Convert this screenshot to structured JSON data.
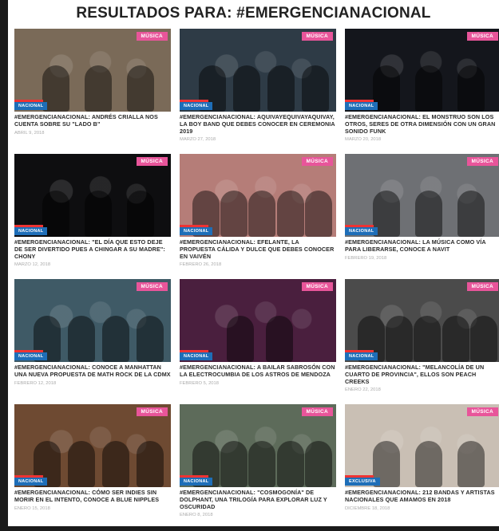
{
  "page": {
    "title": "RESULTADOS PARA: #EMERGENCIANACIONAL"
  },
  "colors": {
    "genre_badge": "#e8559a",
    "section_badge": "#1e6eb8",
    "rail": "#1a1a1a"
  },
  "cards": [
    {
      "genre": "MÚSICA",
      "section": "NACIONAL",
      "title": "#EMERGENCIANACIONAL: ANDRÉS CRIALLA NOS CUENTA SOBRE SU \"LADO B\"",
      "date": "ABRIL 9, 2018",
      "bg": "#7a6a58",
      "figures": 3
    },
    {
      "genre": "MÚSICA",
      "section": "NACIONAL",
      "title": "#EMERGENCIANACIONAL: AQUIVAYEQUIVAYAQUIVAY, LA BOY BAND QUE DEBES CONOCER EN CEREMONIA 2019",
      "date": "MARZO 27, 2018",
      "bg": "#2e3b46",
      "figures": 4
    },
    {
      "genre": "MÚSICA",
      "section": "NACIONAL",
      "title": "#EMERGENCIANACIONAL: EL MONSTRUO SON LOS OTROS, SERES DE OTRA DIMENSIÓN CON UN GRAN SONIDO FUNK",
      "date": "MARZO 20, 2018",
      "bg": "#14161c",
      "figures": 3
    },
    {
      "genre": "MÚSICA",
      "section": "NACIONAL",
      "title": "#EMERGENCIANACIONAL: \"EL DÍA QUE ESTO DEJE DE SER DIVERTIDO PUES A CHINGAR A SU MADRE\": CHONY",
      "date": "MARZO 12, 2018",
      "bg": "#0e0e10",
      "figures": 3
    },
    {
      "genre": "MÚSICA",
      "section": "NACIONAL",
      "title": "#EMERGENCIANACIONAL: EFELANTE, LA PROPUESTA CÁLIDA Y DULCE QUE DEBES CONOCER EN VAIVÉN",
      "date": "FEBRERO 26, 2018",
      "bg": "#b57d78",
      "figures": 5
    },
    {
      "genre": "MÚSICA",
      "section": "NACIONAL",
      "title": "#EMERGENCIANACIONAL: LA MÚSICA COMO VÍA PARA LIBERARSE, CONOCE A NAVIT",
      "date": "FEBRERO 19, 2018",
      "bg": "#6e7074",
      "figures": 3
    },
    {
      "genre": "MÚSICA",
      "section": "NACIONAL",
      "title": "#EMERGENCIANACIONAL: CONOCE A MANHATTAN UNA NUEVA PROPUESTA DE MATH ROCK DE LA CDMX",
      "date": "FEBRERO 12, 2018",
      "bg": "#3f5a66",
      "figures": 4
    },
    {
      "genre": "MÚSICA",
      "section": "NACIONAL",
      "title": "#EMERGENCIANACIONAL: A BAILAR SABROSÓN CON LA ELECTROCUMBIA DE LOS ASTROS DE MENDOZA",
      "date": "FEBRERO 5, 2018",
      "bg": "#4a1f3e",
      "figures": 2
    },
    {
      "genre": "MÚSICA",
      "section": "NACIONAL",
      "title": "#EMERGENCIANACIONAL: \"MELANCOLÍA DE UN CUARTO DE PROVINCIA\", ELLOS SON PEACH CREEKS",
      "date": "ENERO 22, 2018",
      "bg": "#4b4b4b",
      "figures": 5
    },
    {
      "genre": "MÚSICA",
      "section": "NACIONAL",
      "title": "#EMERGENCIANACIONAL: CÓMO SER INDIES SIN MORIR EN EL INTENTO, CONOCE A BLUE NIPPLES",
      "date": "ENERO 15, 2018",
      "bg": "#6e4a32",
      "figures": 4
    },
    {
      "genre": "MÚSICA",
      "section": "NACIONAL",
      "title": "#EMERGENCIANACIONAL: \"COSMOGONÍA\" DE DOLPHANT, UNA TRILOGÍA PARA EXPLORAR LUZ Y OSCURIDAD",
      "date": "ENERO 8, 2018",
      "bg": "#5d6b5a",
      "figures": 5
    },
    {
      "genre": "MÚSICA",
      "section": "EXCLUSIVA",
      "title": "#EMERGENCIANACIONAL: 212 BANDAS Y ARTISTAS NACIONALES QUE AMAMOS EN 2018",
      "date": "DICIEMBRE 18, 2018",
      "bg": "#c9bfb4",
      "figures": 3
    }
  ]
}
